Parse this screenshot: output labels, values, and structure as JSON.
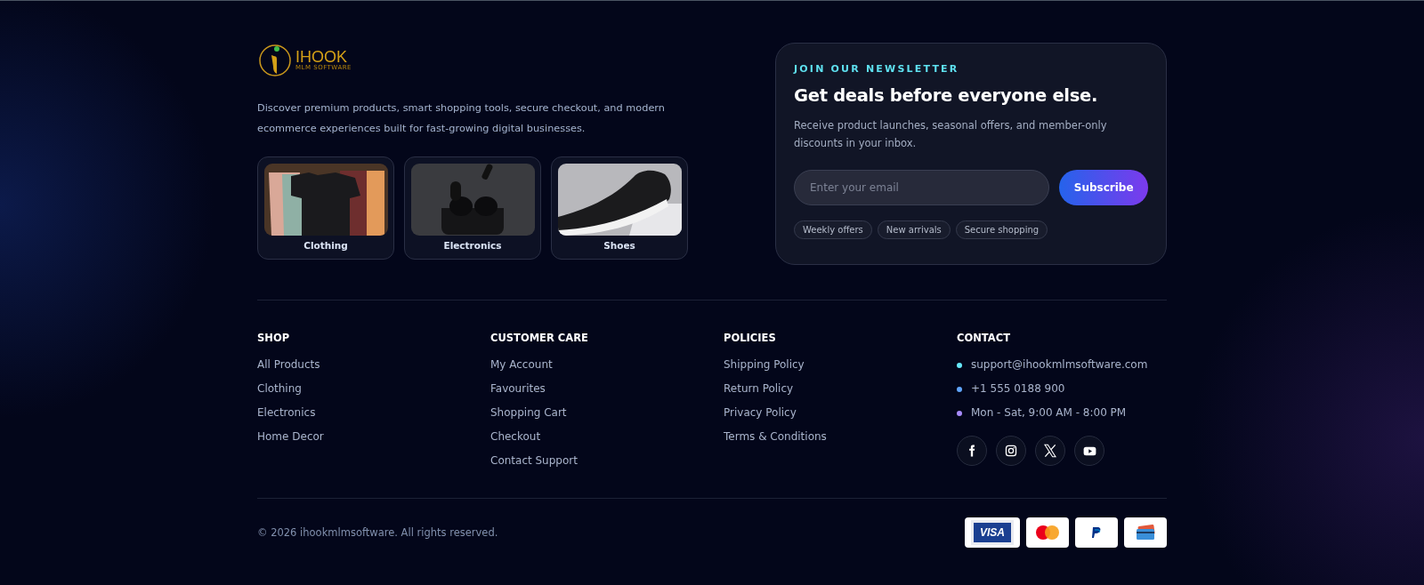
{
  "brand": {
    "name": "IHOOK",
    "tagline": "MLM SOFTWARE"
  },
  "description": "Discover premium products, smart shopping tools, secure checkout, and modern ecommerce experiences built for fast-growing digital businesses.",
  "categories": [
    {
      "label": "Clothing",
      "kind": "clothing"
    },
    {
      "label": "Electronics",
      "kind": "electronics"
    },
    {
      "label": "Shoes",
      "kind": "shoes"
    }
  ],
  "newsletter": {
    "eyebrow": "JOIN OUR NEWSLETTER",
    "title": "Get deals before everyone else.",
    "text": "Receive product launches, seasonal offers, and member-only discounts in your inbox.",
    "placeholder": "Enter your email",
    "button": "Subscribe",
    "tags": [
      "Weekly offers",
      "New arrivals",
      "Secure shopping"
    ]
  },
  "columns": [
    {
      "heading": "SHOP",
      "links": [
        "All Products",
        "Clothing",
        "Electronics",
        "Home Decor"
      ]
    },
    {
      "heading": "CUSTOMER CARE",
      "links": [
        "My Account",
        "Favourites",
        "Shopping Cart",
        "Checkout",
        "Contact Support"
      ]
    },
    {
      "heading": "POLICIES",
      "links": [
        "Shipping Policy",
        "Return Policy",
        "Privacy Policy",
        "Terms & Conditions"
      ]
    }
  ],
  "contact": {
    "heading": "CONTACT",
    "items": [
      {
        "text": "support@ihookmlmsoftware.com",
        "color": "#67e8f9"
      },
      {
        "text": "+1 555 0188 900",
        "color": "#60a5fa"
      },
      {
        "text": "Mon - Sat, 9:00 AM - 8:00 PM",
        "color": "#a78bfa"
      }
    ],
    "socials": [
      {
        "kind": "facebook"
      },
      {
        "kind": "instagram"
      },
      {
        "kind": "x"
      },
      {
        "kind": "youtube"
      }
    ]
  },
  "copyright": "© 2026 ihookmlmsoftware. All rights reserved.",
  "payments": [
    {
      "kind": "visa",
      "label": "VISA"
    },
    {
      "kind": "mastercard"
    },
    {
      "kind": "paypal"
    },
    {
      "kind": "card"
    }
  ]
}
